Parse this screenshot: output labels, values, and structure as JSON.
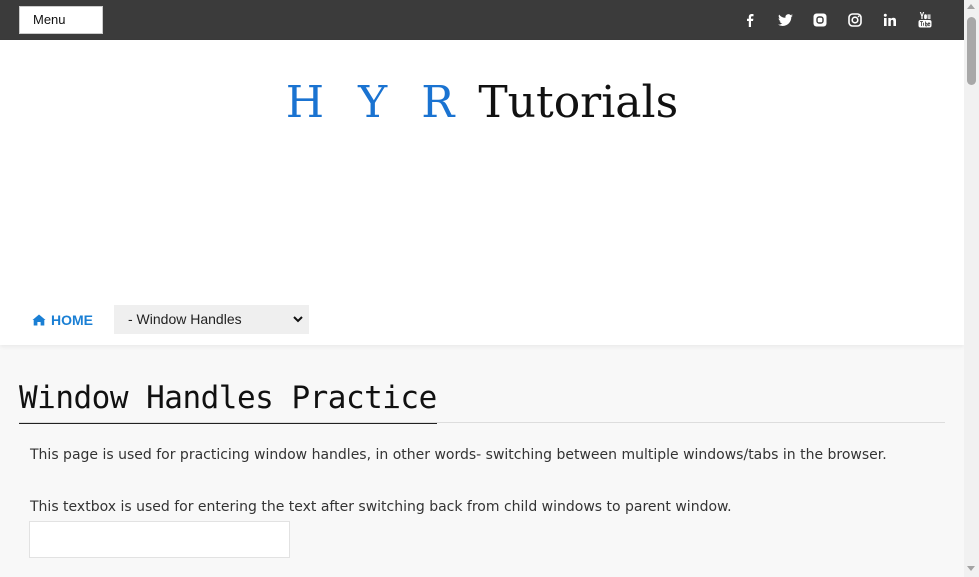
{
  "topbar": {
    "menu_select": {
      "value": "Menu"
    },
    "social_icons": [
      "facebook-icon",
      "twitter-icon",
      "blogger-icon",
      "instagram-icon",
      "linkedin-icon",
      "youtube-icon"
    ]
  },
  "header": {
    "logo_accent": "H Y R",
    "logo_text": "Tutorials",
    "home_label": "HOME",
    "page_select": {
      "value": "- Window Handles"
    }
  },
  "main": {
    "title": "Window Handles Practice",
    "intro": "This page is used for practicing window handles, in other words- switching between multiple windows/tabs in the browser.",
    "textbox_label": "This textbox is used for entering the text after switching back from child windows to parent window.",
    "textbox": {
      "value": "",
      "placeholder": ""
    }
  },
  "colors": {
    "topbar": "#3b3b3b",
    "accent": "#1a73d1",
    "home_link": "#1a7fd4"
  }
}
